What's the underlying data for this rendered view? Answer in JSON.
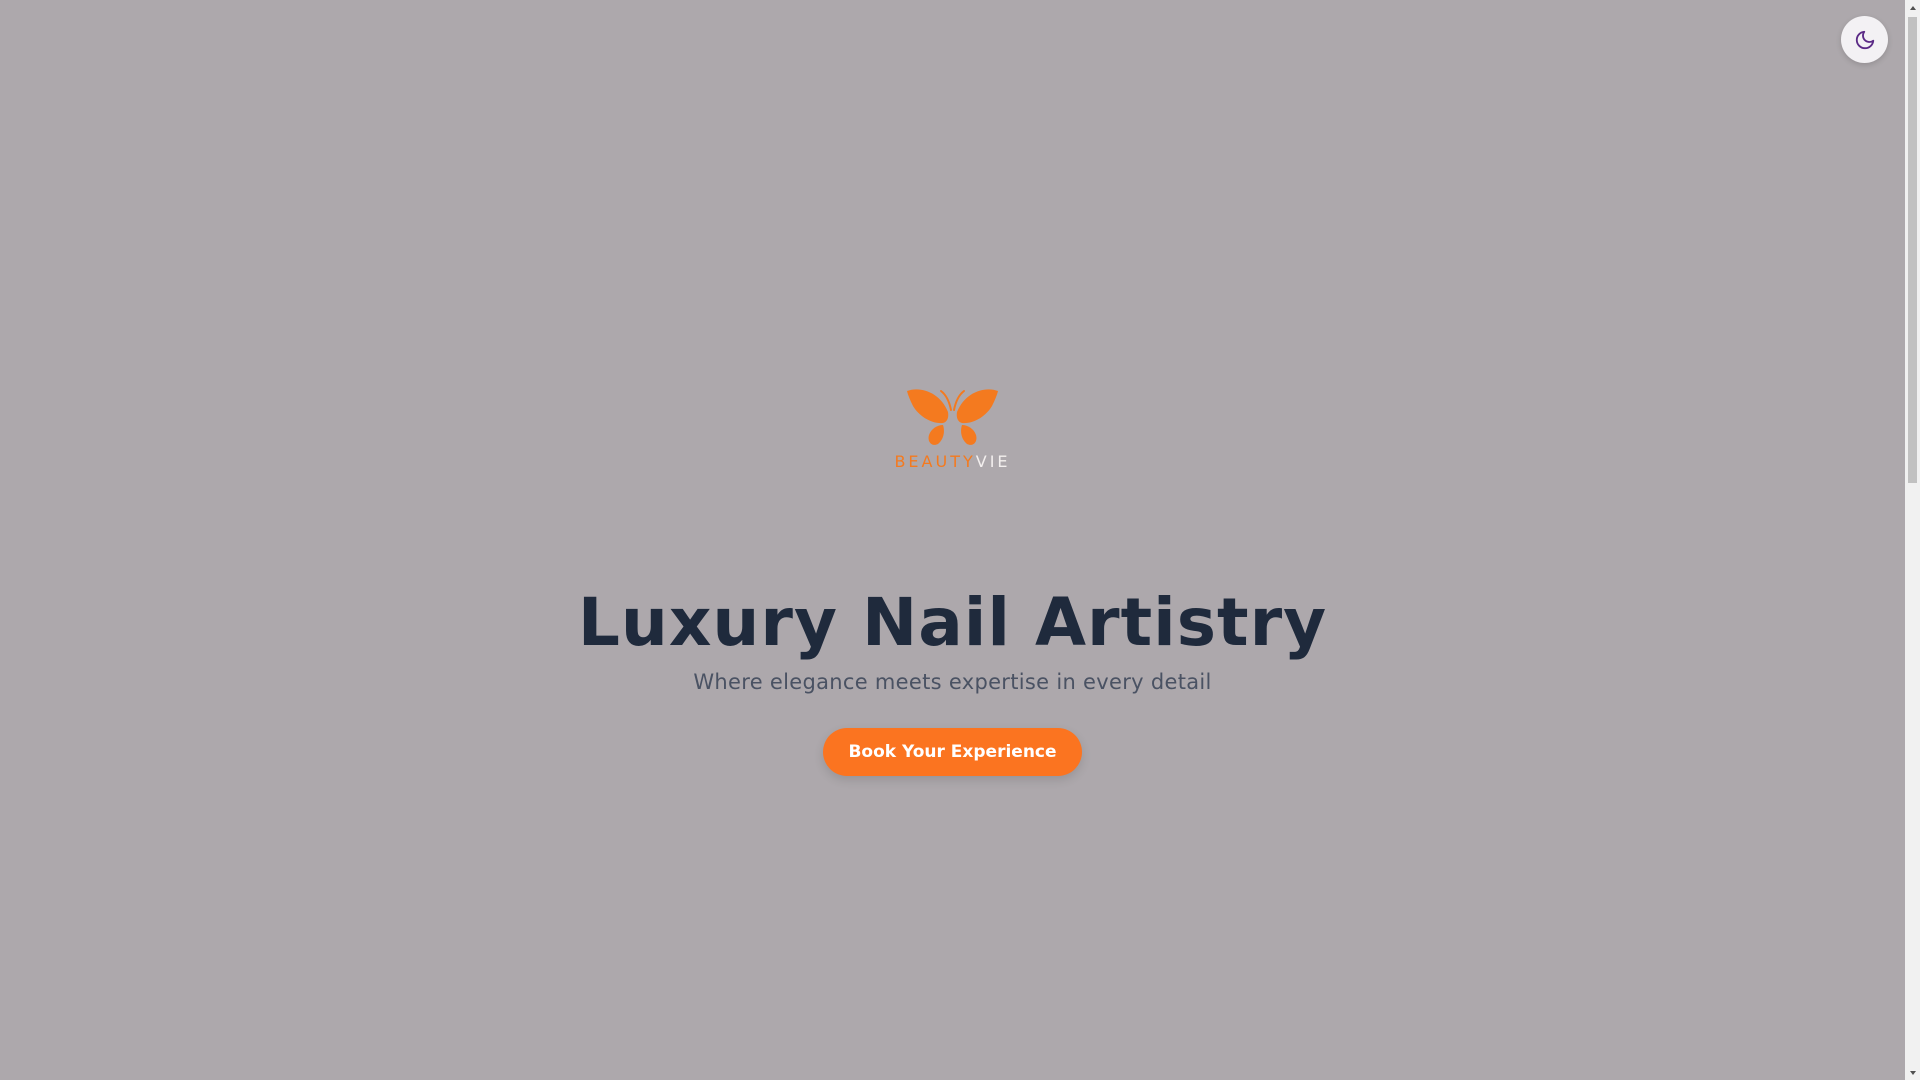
{
  "brand": {
    "word_primary": "BEAUTY",
    "word_secondary": "VIE",
    "accent_color": "#f47a1f"
  },
  "hero": {
    "title": "Luxury Nail Artistry",
    "subtitle": "Where elegance meets expertise in every detail",
    "cta_label": "Book Your Experience"
  },
  "theme_toggle": {
    "icon": "moon-icon"
  },
  "colors": {
    "background": "#ada8ac",
    "title": "#1f2a3c",
    "subtitle": "#4a5263",
    "cta": "#fb7420"
  }
}
